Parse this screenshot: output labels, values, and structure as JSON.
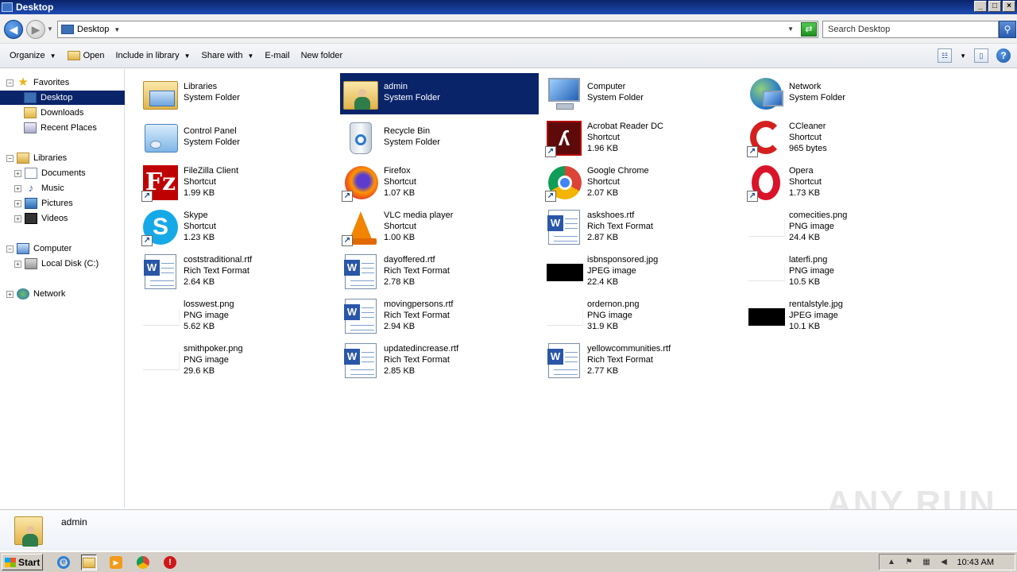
{
  "window": {
    "title": "Desktop",
    "buttons": {
      "minimize": "_",
      "maximize": "□",
      "close": "×"
    }
  },
  "address": {
    "path": "Desktop",
    "search_placeholder": "Search Desktop"
  },
  "toolbar": {
    "organize": "Organize",
    "open": "Open",
    "include_in_library": "Include in library",
    "share_with": "Share with",
    "email": "E-mail",
    "new_folder": "New folder",
    "help": "?"
  },
  "nav": {
    "favorites": "Favorites",
    "desktop": "Desktop",
    "downloads": "Downloads",
    "recent_places": "Recent Places",
    "libraries": "Libraries",
    "documents": "Documents",
    "music": "Music",
    "pictures": "Pictures",
    "videos": "Videos",
    "computer": "Computer",
    "local_disk": "Local Disk (C:)",
    "network": "Network"
  },
  "items": [
    {
      "name": "Libraries",
      "type": "System Folder",
      "size": ""
    },
    {
      "name": "admin",
      "type": "System Folder",
      "size": ""
    },
    {
      "name": "Computer",
      "type": "System Folder",
      "size": ""
    },
    {
      "name": "Network",
      "type": "System Folder",
      "size": ""
    },
    {
      "name": "Control Panel",
      "type": "System Folder",
      "size": ""
    },
    {
      "name": "Recycle Bin",
      "type": "System Folder",
      "size": ""
    },
    {
      "name": "Acrobat Reader DC",
      "type": "Shortcut",
      "size": "1.96 KB"
    },
    {
      "name": "CCleaner",
      "type": "Shortcut",
      "size": "965 bytes"
    },
    {
      "name": "FileZilla Client",
      "type": "Shortcut",
      "size": "1.99 KB"
    },
    {
      "name": "Firefox",
      "type": "Shortcut",
      "size": "1.07 KB"
    },
    {
      "name": "Google Chrome",
      "type": "Shortcut",
      "size": "2.07 KB"
    },
    {
      "name": "Opera",
      "type": "Shortcut",
      "size": "1.73 KB"
    },
    {
      "name": "Skype",
      "type": "Shortcut",
      "size": "1.23 KB"
    },
    {
      "name": "VLC media player",
      "type": "Shortcut",
      "size": "1.00 KB"
    },
    {
      "name": "askshoes.rtf",
      "type": "Rich Text Format",
      "size": "2.87 KB"
    },
    {
      "name": "comecities.png",
      "type": "PNG image",
      "size": "24.4 KB"
    },
    {
      "name": "coststraditional.rtf",
      "type": "Rich Text Format",
      "size": "2.64 KB"
    },
    {
      "name": "dayoffered.rtf",
      "type": "Rich Text Format",
      "size": "2.78 KB"
    },
    {
      "name": "isbnsponsored.jpg",
      "type": "JPEG image",
      "size": "22.4 KB"
    },
    {
      "name": "laterfi.png",
      "type": "PNG image",
      "size": "10.5 KB"
    },
    {
      "name": "losswest.png",
      "type": "PNG image",
      "size": "5.62 KB"
    },
    {
      "name": "movingpersons.rtf",
      "type": "Rich Text Format",
      "size": "2.94 KB"
    },
    {
      "name": "ordernon.png",
      "type": "PNG image",
      "size": "31.9 KB"
    },
    {
      "name": "rentalstyle.jpg",
      "type": "JPEG image",
      "size": "10.1 KB"
    },
    {
      "name": "smithpoker.png",
      "type": "PNG image",
      "size": "29.6 KB"
    },
    {
      "name": "updatedincrease.rtf",
      "type": "Rich Text Format",
      "size": "2.85 KB"
    },
    {
      "name": "yellowcommunities.rtf",
      "type": "Rich Text Format",
      "size": "2.77 KB"
    }
  ],
  "details": {
    "name": "admin"
  },
  "watermark": "ANY RUN",
  "taskbar": {
    "start": "Start",
    "clock": "10:43 AM"
  }
}
